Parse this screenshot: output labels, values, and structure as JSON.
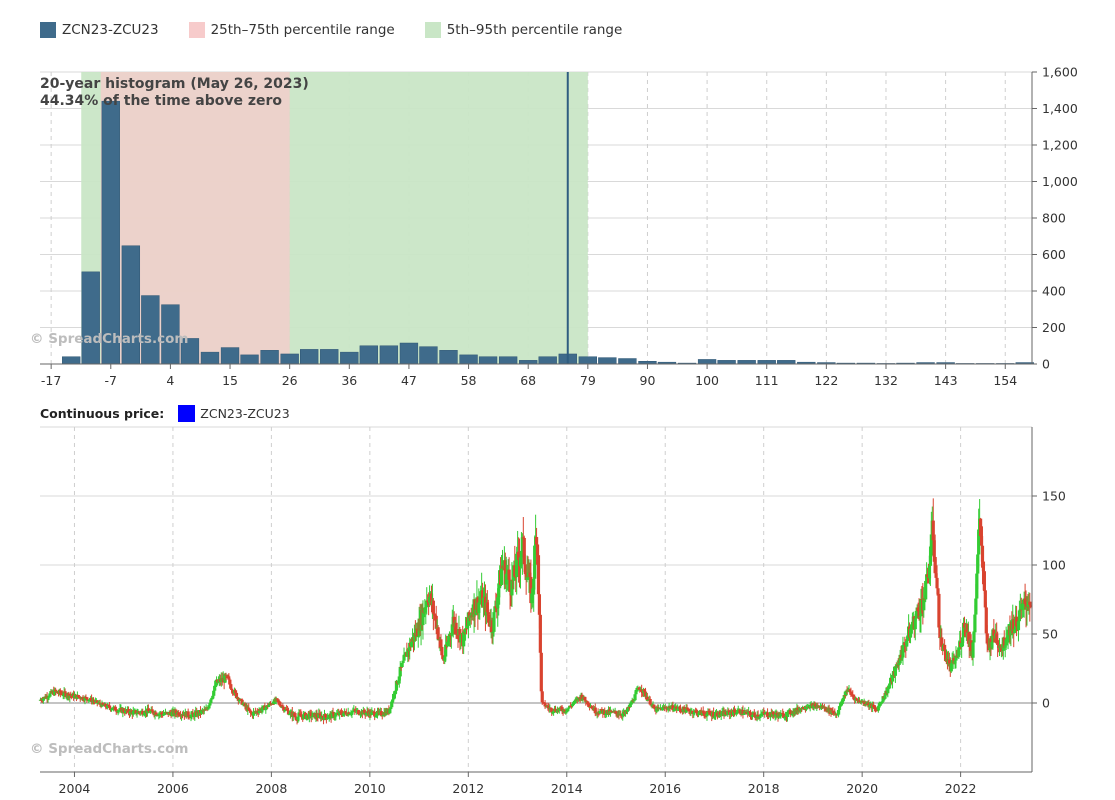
{
  "legend": {
    "items": [
      {
        "label": "ZCN23-ZCU23",
        "color": "#3f6b8b"
      },
      {
        "label": "25th–75th percentile range",
        "color": "#f7cbcb"
      },
      {
        "label": "5th–95th percentile range",
        "color": "#c9e6c6"
      }
    ]
  },
  "watermark": "© SpreadCharts.com",
  "continuous": {
    "label": "Continuous price:",
    "series": "ZCN23-ZCU23",
    "swatch_color": "#0000ff"
  },
  "chart_data": [
    {
      "type": "bar",
      "title": "20-year histogram (May 26, 2023)",
      "subtitle": "44.34% of the time above zero",
      "series_name": "ZCN23-ZCU23",
      "bar_color": "#3f6b8b",
      "x_tick_labels": [
        "-17",
        "-7",
        "4",
        "15",
        "26",
        "36",
        "47",
        "58",
        "68",
        "79",
        "90",
        "100",
        "111",
        "122",
        "132",
        "143",
        "154"
      ],
      "x_ticks": [
        -17,
        -6.3,
        4.4,
        15.1,
        25.8,
        36.5,
        47.2,
        57.9,
        68.6,
        79.3,
        90,
        100.7,
        111.4,
        122.1,
        132.8,
        143.5,
        154.2
      ],
      "xlim": [
        -19,
        159
      ],
      "y_tick_labels": [
        "0",
        "200",
        "400",
        "600",
        "800",
        "1,000",
        "1,200",
        "1,400",
        "1,600"
      ],
      "ylim": [
        0,
        1600
      ],
      "bin_width": 3.56,
      "bin_centers": [
        -13.4,
        -9.9,
        -6.3,
        -2.7,
        0.8,
        4.4,
        7.9,
        11.5,
        15.1,
        18.6,
        22.2,
        25.8,
        29.3,
        32.9,
        36.5,
        40.0,
        43.6,
        47.2,
        50.7,
        54.3,
        57.9,
        61.4,
        65.0,
        68.6,
        72.1,
        75.7,
        79.3,
        82.8,
        86.4,
        90.0,
        93.5,
        97.1,
        100.7,
        104.2,
        107.8,
        111.4,
        114.9,
        118.5,
        122.1,
        125.6,
        129.2,
        132.8,
        136.3,
        139.9,
        143.5,
        147.0,
        150.6,
        154.2,
        157.7
      ],
      "values": [
        40,
        505,
        1440,
        648,
        375,
        325,
        140,
        65,
        90,
        50,
        75,
        55,
        80,
        80,
        65,
        100,
        100,
        115,
        95,
        75,
        50,
        40,
        40,
        20,
        40,
        55,
        40,
        35,
        30,
        15,
        10,
        5,
        25,
        20,
        20,
        20,
        20,
        10,
        8,
        5,
        5,
        3,
        5,
        8,
        8,
        3,
        3,
        3,
        8
      ],
      "bands": [
        {
          "name": "5th–95th percentile range",
          "from": -11.6,
          "to": 79.3,
          "color": "#c9e6c6"
        },
        {
          "name": "25th–75th percentile range",
          "from": -8.1,
          "to": 25.8,
          "color": "#f7cbcb"
        }
      ],
      "current_marker": 75.7,
      "grid": true
    },
    {
      "type": "candlestick",
      "series_name": "ZCN23-ZCU23",
      "x_tick_labels": [
        "2004",
        "2006",
        "2008",
        "2010",
        "2012",
        "2014",
        "2016",
        "2018",
        "2020",
        "2022"
      ],
      "x_ticks": [
        2004,
        2006,
        2008,
        2010,
        2012,
        2014,
        2016,
        2018,
        2020,
        2022
      ],
      "xlim": [
        2003.3,
        2023.45
      ],
      "y_tick_labels": [
        "0",
        "50",
        "100",
        "150"
      ],
      "y_ticks": [
        0,
        50,
        100,
        150
      ],
      "ylim": [
        -50,
        200
      ],
      "up_color": "#33cc33",
      "down_color": "#d9432f",
      "zero_line": true,
      "grid": true,
      "points": [
        [
          2003.3,
          2
        ],
        [
          2003.6,
          8
        ],
        [
          2004.0,
          5
        ],
        [
          2004.3,
          3
        ],
        [
          2004.6,
          -2
        ],
        [
          2004.9,
          -5
        ],
        [
          2005.2,
          -7
        ],
        [
          2005.5,
          -6
        ],
        [
          2005.8,
          -8
        ],
        [
          2006.1,
          -7
        ],
        [
          2006.4,
          -9
        ],
        [
          2006.7,
          -5
        ],
        [
          2006.9,
          15
        ],
        [
          2007.1,
          18
        ],
        [
          2007.3,
          5
        ],
        [
          2007.6,
          -8
        ],
        [
          2007.9,
          -3
        ],
        [
          2008.1,
          2
        ],
        [
          2008.3,
          -5
        ],
        [
          2008.5,
          -10
        ],
        [
          2008.8,
          -9
        ],
        [
          2009.1,
          -10
        ],
        [
          2009.4,
          -8
        ],
        [
          2009.7,
          -6
        ],
        [
          2009.9,
          -7
        ],
        [
          2010.2,
          -8
        ],
        [
          2010.4,
          -6
        ],
        [
          2010.6,
          20
        ],
        [
          2010.8,
          40
        ],
        [
          2011.0,
          55
        ],
        [
          2011.2,
          80
        ],
        [
          2011.35,
          60
        ],
        [
          2011.5,
          30
        ],
        [
          2011.7,
          60
        ],
        [
          2011.9,
          45
        ],
        [
          2012.1,
          70
        ],
        [
          2012.3,
          75
        ],
        [
          2012.5,
          55
        ],
        [
          2012.7,
          100
        ],
        [
          2012.9,
          85
        ],
        [
          2013.1,
          115
        ],
        [
          2013.3,
          75
        ],
        [
          2013.4,
          130
        ],
        [
          2013.5,
          0
        ],
        [
          2013.7,
          -5
        ],
        [
          2014.0,
          -5
        ],
        [
          2014.3,
          5
        ],
        [
          2014.6,
          -6
        ],
        [
          2014.9,
          -7
        ],
        [
          2015.2,
          -8
        ],
        [
          2015.5,
          12
        ],
        [
          2015.8,
          -5
        ],
        [
          2016.1,
          -3
        ],
        [
          2016.4,
          -5
        ],
        [
          2016.7,
          -7
        ],
        [
          2016.9,
          -8
        ],
        [
          2017.2,
          -8
        ],
        [
          2017.5,
          -6
        ],
        [
          2017.8,
          -9
        ],
        [
          2018.1,
          -8
        ],
        [
          2018.4,
          -9
        ],
        [
          2018.7,
          -5
        ],
        [
          2018.9,
          -2
        ],
        [
          2019.2,
          -3
        ],
        [
          2019.5,
          -8
        ],
        [
          2019.7,
          10
        ],
        [
          2019.9,
          2
        ],
        [
          2020.1,
          0
        ],
        [
          2020.3,
          -5
        ],
        [
          2020.5,
          8
        ],
        [
          2020.7,
          25
        ],
        [
          2020.9,
          45
        ],
        [
          2021.1,
          62
        ],
        [
          2021.3,
          80
        ],
        [
          2021.45,
          125
        ],
        [
          2021.6,
          45
        ],
        [
          2021.8,
          25
        ],
        [
          2021.95,
          35
        ],
        [
          2022.1,
          60
        ],
        [
          2022.25,
          35
        ],
        [
          2022.4,
          135
        ],
        [
          2022.55,
          40
        ],
        [
          2022.7,
          50
        ],
        [
          2022.85,
          40
        ],
        [
          2023.0,
          55
        ],
        [
          2023.15,
          58
        ],
        [
          2023.3,
          70
        ],
        [
          2023.4,
          75
        ]
      ]
    }
  ]
}
